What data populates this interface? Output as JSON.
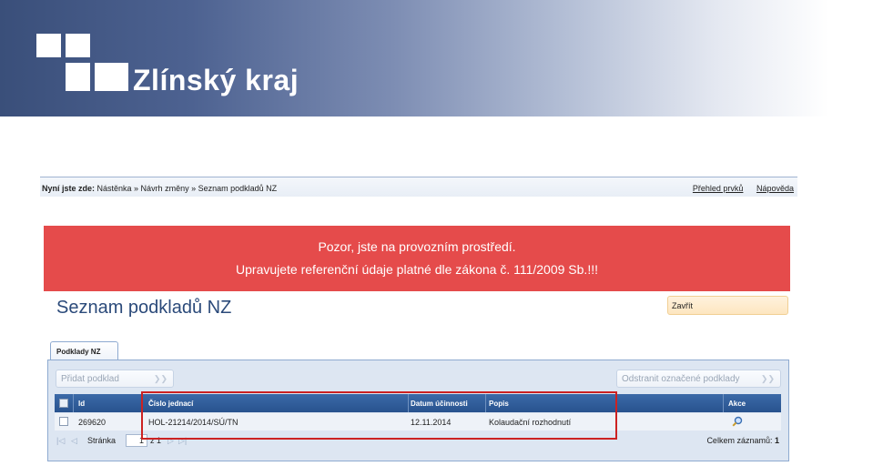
{
  "header": {
    "logo_text": "Zlínský kraj"
  },
  "breadcrumb": {
    "prefix": "Nyní jste zde:",
    "path": "Nástěnka » Návrh změny » Seznam podkladů NZ",
    "links": [
      "Přehled prvků",
      "Nápověda"
    ]
  },
  "warning": {
    "line1": "Pozor, jste na provozním prostředí.",
    "line2": "Upravujete referenční údaje platné dle zákona č. 111/2009 Sb.!!!"
  },
  "page": {
    "title": "Seznam podkladů NZ",
    "close_label": "Zavřít"
  },
  "tabs": [
    {
      "label": "Podklady NZ"
    }
  ],
  "toolbar": {
    "add_label": "Přidat podklad",
    "remove_label": "Odstranit označené podklady"
  },
  "table": {
    "columns": [
      "Id",
      "Číslo jednací",
      "Datum účinnosti",
      "Popis",
      "Akce"
    ],
    "rows": [
      {
        "id": "269620",
        "cislo": "HOL-21214/2014/SÚ/TN",
        "datum": "12.11.2014",
        "popis": "Kolaudační rozhodnutí"
      }
    ]
  },
  "pager": {
    "page_label": "Stránka",
    "page_value": "1",
    "of_label": "z 1",
    "total_label": "Celkem záznamů:",
    "total_value": "1"
  },
  "colors": {
    "accent": "#28528e",
    "warning_bg": "#e54b4b",
    "highlight_border": "#cc2222"
  },
  "icons": [
    "logo-mark-icon",
    "chevron-right-icon",
    "checkbox-icon",
    "magnifier-icon",
    "first-page-icon",
    "prev-page-icon",
    "next-page-icon",
    "last-page-icon"
  ]
}
